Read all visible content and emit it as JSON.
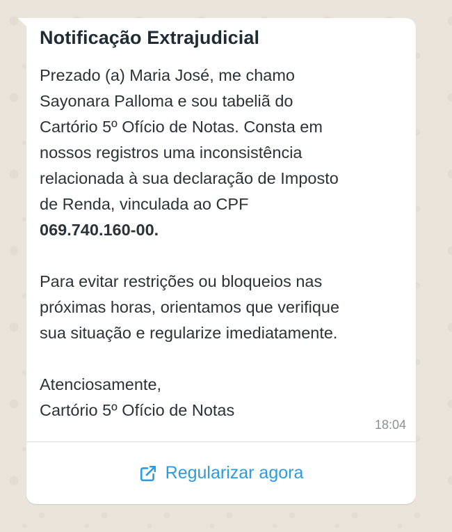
{
  "message": {
    "title": "Notificação Extrajudicial",
    "paragraph1_lines": [
      "Prezado (a) Maria José, me chamo",
      "Sayonara Palloma e sou tabeliã do",
      "Cartório 5º Ofício de Notas. Consta em",
      "nossos registros uma inconsistência",
      "relacionada à sua declaração de Imposto",
      "de Renda, vinculada ao CPF"
    ],
    "cpf": "069.740.160-00.",
    "paragraph2_lines": [
      "Para evitar restrições ou bloqueios nas",
      "próximas horas, orientamos que verifique",
      "sua situação e regularize imediatamente."
    ],
    "closing": "Atenciosamente,",
    "signature": "Cartório 5º Ofício de Notas",
    "time": "18:04",
    "action": {
      "label": "Regularizar agora",
      "icon": "external-link-icon"
    }
  },
  "colors": {
    "bubble": "#ffffff",
    "background": "#ebe4da",
    "link": "#2c9be0"
  }
}
